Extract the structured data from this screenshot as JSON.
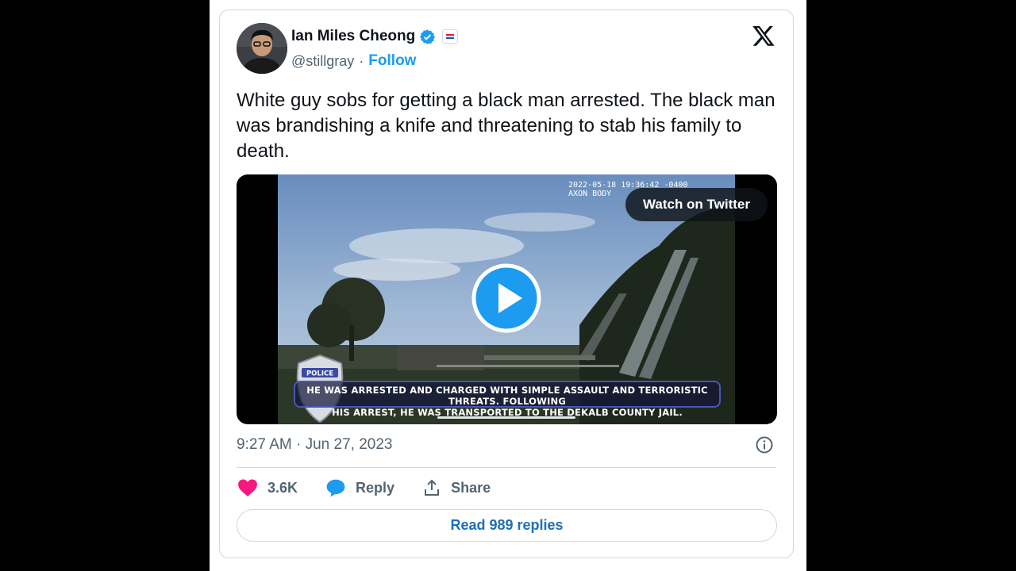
{
  "tweet": {
    "author": {
      "display_name": "Ian Miles Cheong",
      "handle": "@stillgray",
      "separator": "·",
      "follow_label": "Follow",
      "verified_icon": "verified-badge-icon",
      "affiliate_icon": "affiliate-badge-icon"
    },
    "text": "White guy sobs for getting a black man arrested. The black man was brandishing a knife and threatening to stab his family to death.",
    "media": {
      "type": "video",
      "watch_label": "Watch on Twitter",
      "overlay_timestamp_line1": "2022-05-18 19:36:42 -0400",
      "overlay_timestamp_line2": "AXON BODY",
      "badge_text": "POLICE",
      "caption_line1": "HE WAS ARRESTED AND CHARGED WITH SIMPLE ASSAULT AND TERRORISTIC THREATS. FOLLOWING",
      "caption_line2": "HIS ARREST, HE WAS TRANSPORTED TO THE DEKALB COUNTY JAIL."
    },
    "timestamp": "9:27 AM · Jun 27, 2023",
    "actions": {
      "likes": "3.6K",
      "reply_label": "Reply",
      "share_label": "Share"
    },
    "read_replies_label": "Read 989 replies"
  },
  "colors": {
    "brand_blue": "#1d9bf0",
    "like_pink": "#f91880",
    "text_primary": "#0f1419",
    "text_secondary": "#536471",
    "border": "#cfd9de"
  }
}
